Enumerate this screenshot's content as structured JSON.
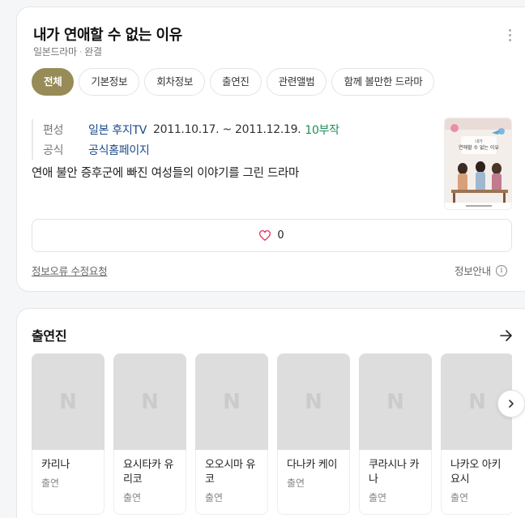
{
  "info": {
    "title": "내가 연애할 수 없는 이유",
    "genre": "일본드라마",
    "status": "완결",
    "tabs": [
      "전체",
      "기본정보",
      "회차정보",
      "출연진",
      "관련앨범",
      "함께 볼만한 드라마"
    ],
    "broadcast_label": "편성",
    "broadcaster": "일본 후지TV",
    "air_dates": "2011.10.17. ~ 2011.12.19.",
    "episodes": "10부작",
    "official_label": "공식",
    "official_link": "공식홈페이지",
    "description": "연애 불안 증후군에 빠진 여성들의 이야기를 그린 드라마",
    "poster_text": "내가 연애할 수 없는 이유",
    "like_count": "0",
    "report_link": "정보오류 수정요청",
    "info_guide": "정보안내"
  },
  "cast": {
    "title": "출연진",
    "placeholder": "N",
    "members": [
      {
        "name": "카리나",
        "role": "출연"
      },
      {
        "name": "요시타카 유리코",
        "role": "출연"
      },
      {
        "name": "오오시마 유코",
        "role": "출연"
      },
      {
        "name": "다나카 케이",
        "role": "출연"
      },
      {
        "name": "쿠라시나 카나",
        "role": "출연"
      },
      {
        "name": "나카오 아키요시",
        "role": "출연"
      }
    ]
  },
  "colors": {
    "accent": "#978b57",
    "link": "#1b4a8a",
    "episode_green": "#1e8e55",
    "heart": "#e0355f"
  },
  "icons": [
    "more-icon",
    "heart-icon",
    "info-icon",
    "arrow-right-icon",
    "chevron-right-icon"
  ]
}
